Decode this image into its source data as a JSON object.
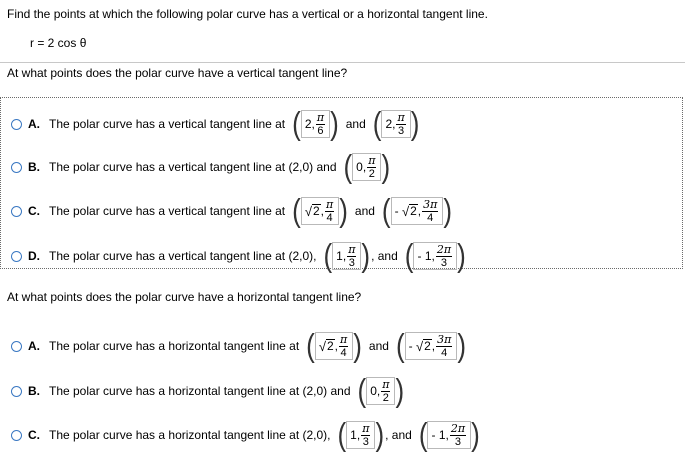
{
  "instruction": "Find the points at which the following polar curve has a vertical or a horizontal tangent line.",
  "equation": "r = 2 cos θ",
  "question1": "At what points does the polar curve have a vertical tangent line?",
  "question2": "At what points does the polar curve have a horizontal tangent line?",
  "q1_options": [
    {
      "letter": "A.",
      "text": "The polar curve has a vertical tangent line at",
      "p1_r": "2",
      "p1_num": "π",
      "p1_den": "6",
      "and": "and",
      "p2_r": "2",
      "p2_num": "π",
      "p2_den": "3"
    },
    {
      "letter": "B.",
      "text": "The polar curve has a vertical tangent line at (2,0) and",
      "p1_r": "0",
      "p1_num": "π",
      "p1_den": "2"
    },
    {
      "letter": "C.",
      "text": "The polar curve has a vertical tangent line at",
      "p1_r": "2",
      "p1_num": "π",
      "p1_den": "4",
      "and": "and",
      "p2_sign": "-",
      "p2_r": "2",
      "p2_num": "3π",
      "p2_den": "4"
    },
    {
      "letter": "D.",
      "text": "The polar curve has a vertical tangent line at (2,0),",
      "p1_r": "1",
      "p1_num": "π",
      "p1_den": "3",
      "and": ", and",
      "p2_sign": "-",
      "p2_r": "1",
      "p2_num": "2π",
      "p2_den": "3"
    }
  ],
  "q2_options": [
    {
      "letter": "A.",
      "text": "The polar curve has a horizontal tangent line at",
      "p1_r": "2",
      "p1_num": "π",
      "p1_den": "4",
      "and": "and",
      "p2_sign": "-",
      "p2_r": "2",
      "p2_num": "3π",
      "p2_den": "4"
    },
    {
      "letter": "B.",
      "text": "The polar curve has a horizontal tangent line at (2,0) and",
      "p1_r": "0",
      "p1_num": "π",
      "p1_den": "2"
    },
    {
      "letter": "C.",
      "text": "The polar curve has a horizontal tangent line at (2,0),",
      "p1_r": "1",
      "p1_num": "π",
      "p1_den": "3",
      "and": ", and",
      "p2_sign": "-",
      "p2_r": "1",
      "p2_num": "2π",
      "p2_den": "3"
    }
  ]
}
